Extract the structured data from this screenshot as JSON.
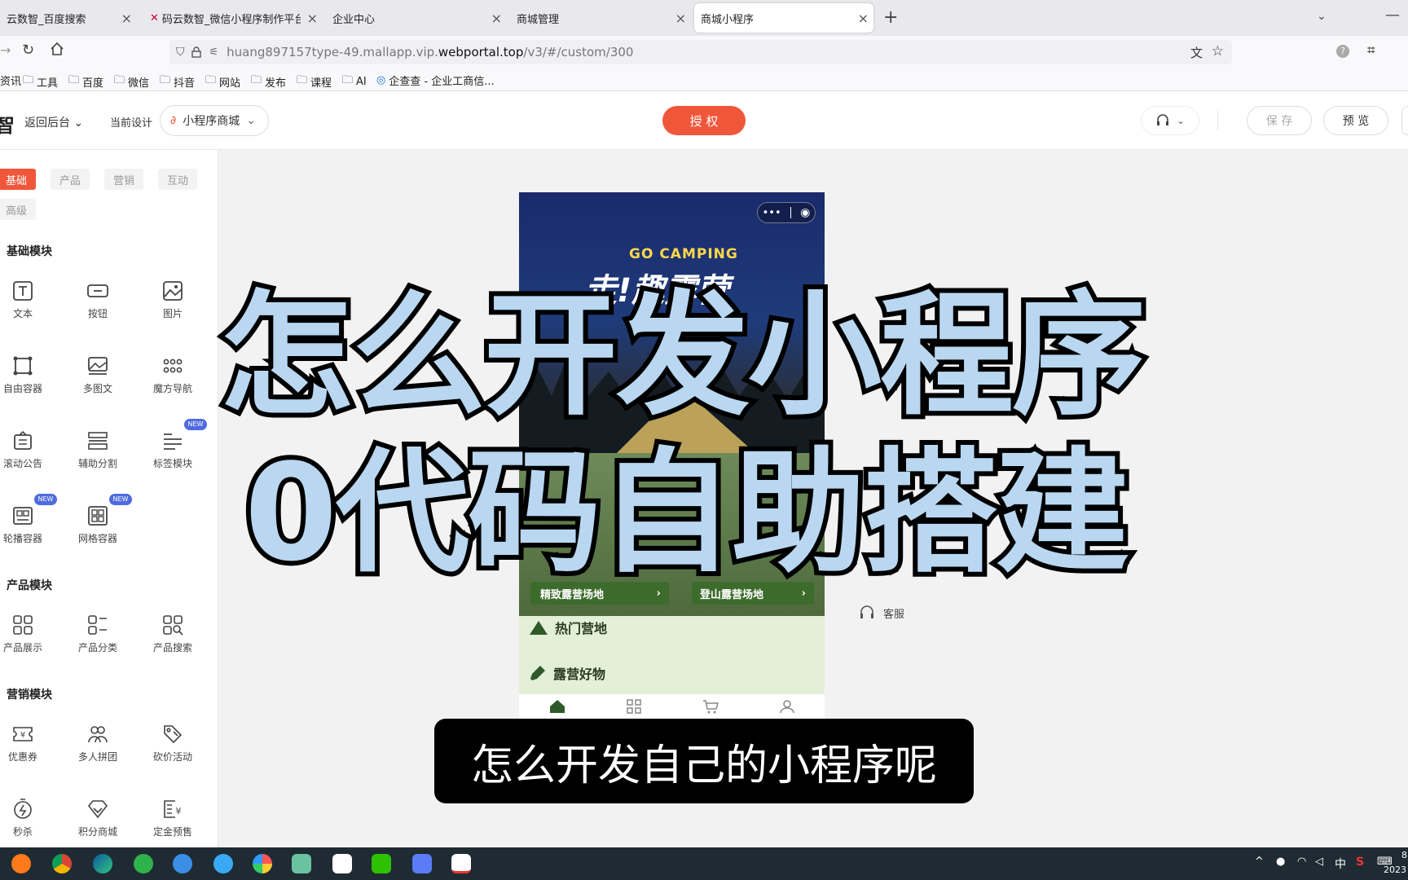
{
  "browser": {
    "tabs": [
      {
        "title": "云数智_百度搜索"
      },
      {
        "title": "码云数智_微信小程序制作平台_"
      },
      {
        "title": "企业中心"
      },
      {
        "title": "商城管理"
      },
      {
        "title": "商城小程序"
      }
    ],
    "url": {
      "prefix": "huang897157type-49.mallapp.vip.",
      "domain": "webportal.top",
      "path": "/v3/#/custom/300"
    },
    "bookmarks": [
      "资讯",
      "工具",
      "百度",
      "微信",
      "抖音",
      "网站",
      "发布",
      "课程",
      "AI",
      "企查查 - 企业工商信..."
    ]
  },
  "header": {
    "logo": "智",
    "back": "返回后台",
    "design_label": "当前设计",
    "design_value": "小程序商城",
    "authorize": "授 权",
    "save": "保 存",
    "preview": "预 览"
  },
  "sidebar": {
    "tabs": [
      "基础",
      "产品",
      "营销",
      "互动",
      "高级"
    ],
    "sections": [
      {
        "title": "基础模块",
        "items": [
          "文本",
          "按钮",
          "图片",
          "自由容器",
          "多图文",
          "魔方导航",
          "滚动公告",
          "辅助分割",
          "标签模块",
          "轮播容器",
          "网格容器"
        ]
      },
      {
        "title": "产品模块",
        "items": [
          "产品展示",
          "产品分类",
          "产品搜索"
        ]
      },
      {
        "title": "营销模块",
        "items": [
          "优惠券",
          "多人拼团",
          "砍价活动",
          "秒杀",
          "积分商城",
          "定金预售"
        ]
      }
    ],
    "new_badge": "NEW"
  },
  "phone": {
    "banner_en": "GO CAMPING",
    "banner_cn": "走!趣露营",
    "card1": "精致露营场地",
    "card2": "登山露营场地",
    "hot": "热门营地",
    "goods": "露营好物"
  },
  "side_tools": {
    "service": "客服"
  },
  "overlay": {
    "line1": "怎么开发小程序",
    "line2": "0代码自助搭建",
    "subtitle": "怎么开发自己的小程序呢"
  },
  "taskbar": {
    "ime": "中",
    "time": "8",
    "date": "2023"
  },
  "colors": {
    "accent": "#f0573a",
    "overlay_text": "#b9d7f0",
    "new_badge": "#4e6bdf"
  }
}
